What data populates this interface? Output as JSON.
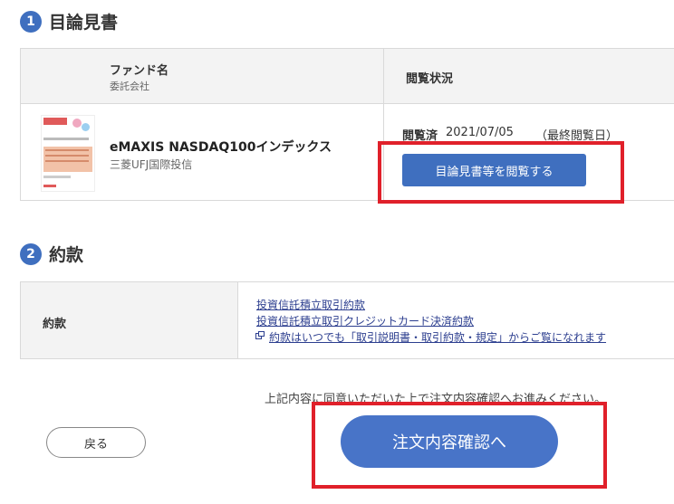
{
  "section1": {
    "number": "1",
    "title": "目論見書"
  },
  "table1": {
    "header_fund": "ファンド名",
    "header_fund_sub": "委託会社",
    "header_status": "閲覧状況",
    "fund_name": "eMAXIS NASDAQ100インデックス",
    "fund_company": "三菱UFJ国際投信",
    "status_label": "閲覧済",
    "status_date": "2021/07/05",
    "status_note": "（最終閲覧日）",
    "view_button": "目論見書等を閲覧する"
  },
  "section2": {
    "number": "2",
    "title": "約款"
  },
  "table2": {
    "label": "約款",
    "links": [
      "投資信託積立取引約款",
      "投資信託積立取引クレジットカード決済約款",
      "約款はいつでも「取引説明書・取引約款・規定」からご覧になれます"
    ]
  },
  "footer": {
    "confirm_note": "上記内容に同意いただいた上で注文内容確認へお進みください。",
    "back_button": "戻る",
    "order_button": "注文内容確認へ"
  },
  "colors": {
    "accent": "#3f6fbf",
    "highlight": "#e0202a"
  }
}
